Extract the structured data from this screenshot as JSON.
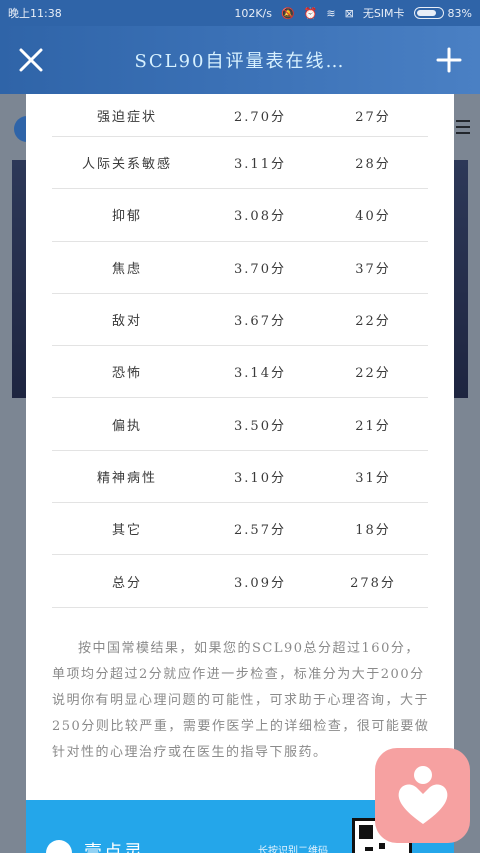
{
  "status_bar": {
    "time": "晚上11:38",
    "speed": "102K/s",
    "carrier": "无SIM卡",
    "battery_percent": "83%",
    "battery_level": 0.83
  },
  "title_bar": {
    "title": "SCL90自评量表在线…",
    "close_icon": "close-icon",
    "add_icon": "plus-icon"
  },
  "results_table": {
    "rows": [
      {
        "name": "强迫症状",
        "avg": "2.70分",
        "total": "27分"
      },
      {
        "name": "人际关系敏感",
        "avg": "3.11分",
        "total": "28分"
      },
      {
        "name": "抑郁",
        "avg": "3.08分",
        "total": "40分"
      },
      {
        "name": "焦虑",
        "avg": "3.70分",
        "total": "37分"
      },
      {
        "name": "敌对",
        "avg": "3.67分",
        "total": "22分"
      },
      {
        "name": "恐怖",
        "avg": "3.14分",
        "total": "22分"
      },
      {
        "name": "偏执",
        "avg": "3.50分",
        "total": "21分"
      },
      {
        "name": "精神病性",
        "avg": "3.10分",
        "total": "31分"
      },
      {
        "name": "其它",
        "avg": "2.57分",
        "total": "18分"
      },
      {
        "name": "总分",
        "avg": "3.09分",
        "total": "278分"
      }
    ]
  },
  "explanation": "按中国常模结果，如果您的SCL90总分超过160分，单项均分超过2分就应作进一步检查，标准分为大于200分说明你有明显心理问题的可能性，可求助于心理咨询，大于250分则比较严重，需要作医学上的详细检查，很可能要做针对性的心理治疗或在医生的指导下服药。",
  "footer": {
    "brand": "壹点灵",
    "hint": "长按识别二维码"
  },
  "colors": {
    "primary": "#2f64a8",
    "footer": "#24a6ea",
    "fab": "#f6a1a1"
  }
}
